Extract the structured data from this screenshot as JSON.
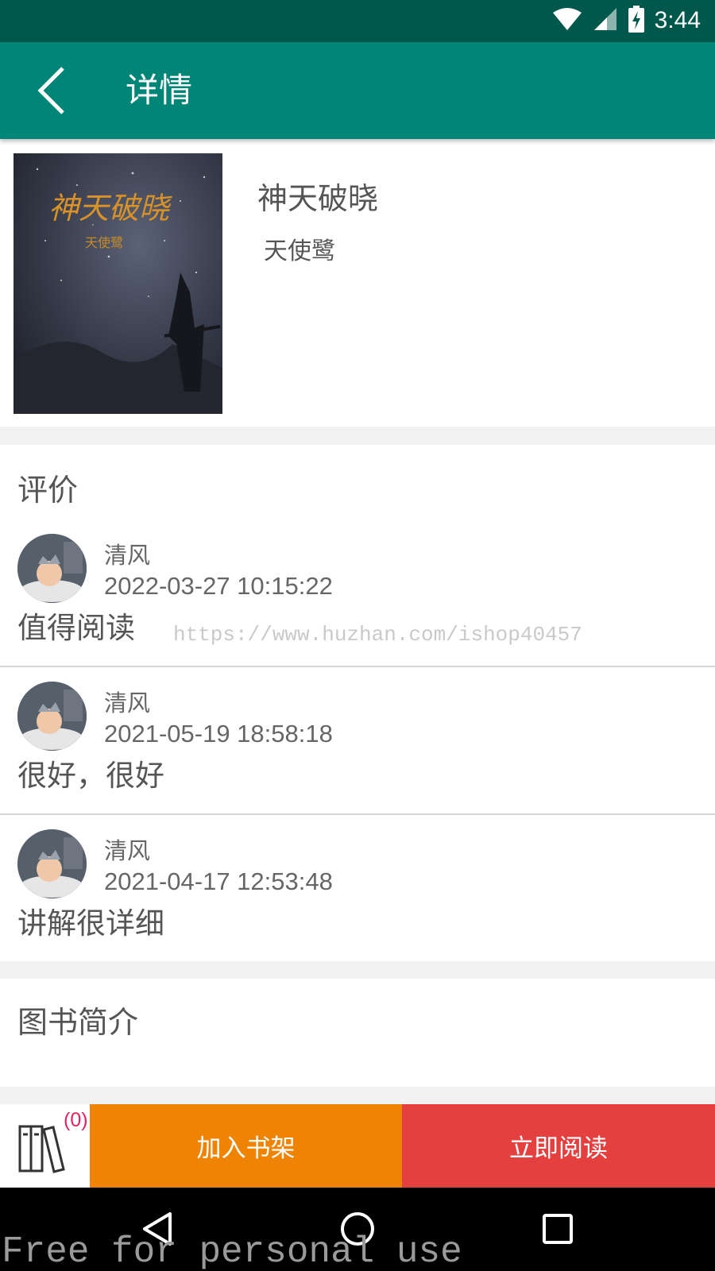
{
  "status_bar": {
    "time": "3:44"
  },
  "app_bar": {
    "title": "详情"
  },
  "book": {
    "title": "神天破晓",
    "author": "天使鹭",
    "cover_text": "神天破晓",
    "cover_subtext": "天使鹭"
  },
  "comments_section": {
    "title": "评价",
    "items": [
      {
        "user": "清风",
        "time": "2022-03-27 10:15:22",
        "text": "值得阅读"
      },
      {
        "user": "清风",
        "time": "2021-05-19 18:58:18",
        "text": "很好，很好"
      },
      {
        "user": "清风",
        "time": "2021-04-17 12:53:48",
        "text": "讲解很详细"
      }
    ]
  },
  "intro": {
    "title": "图书简介"
  },
  "bottom_bar": {
    "shelf_count": "(0)",
    "add_to_shelf": "加入书架",
    "read_now": "立即阅读"
  },
  "watermarks": {
    "url": "https://www.huzhan.com/ishop40457",
    "free": "Free for personal use"
  },
  "colors": {
    "status_bar": "#00574b",
    "app_bar": "#008577",
    "add_button": "#ef8404",
    "read_button": "#e44040",
    "badge": "#e0245e"
  }
}
